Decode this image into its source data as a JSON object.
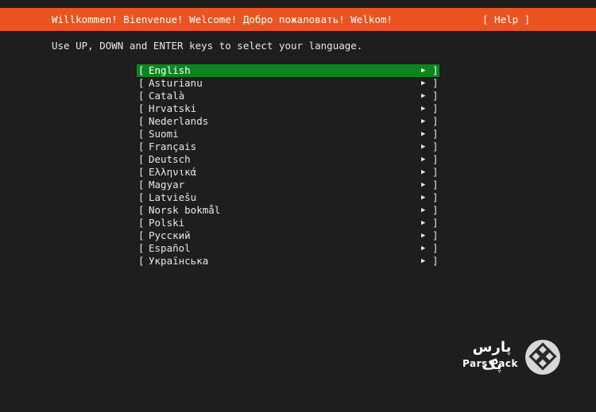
{
  "header": {
    "title": "Willkommen! Bienvenue! Welcome! Добро пожаловать! Welkom!",
    "help_label": "[ Help ]"
  },
  "instructions": "Use UP, DOWN and ENTER keys to select your language.",
  "languages": [
    {
      "label": "English",
      "selected": true
    },
    {
      "label": "Asturianu"
    },
    {
      "label": "Català"
    },
    {
      "label": "Hrvatski"
    },
    {
      "label": "Nederlands"
    },
    {
      "label": "Suomi"
    },
    {
      "label": "Français"
    },
    {
      "label": "Deutsch"
    },
    {
      "label": "Ελληνικά"
    },
    {
      "label": "Magyar"
    },
    {
      "label": "Latviešu"
    },
    {
      "label": "Norsk bokmål"
    },
    {
      "label": "Polski"
    },
    {
      "label": "Русский"
    },
    {
      "label": "Español"
    },
    {
      "label": "Українська"
    }
  ],
  "list_glyphs": {
    "open_bracket": "[",
    "close_bracket": "]",
    "arrow_icon": "▶"
  },
  "logo": {
    "text_fa": "پارس پک",
    "text_en": "Pars Pack",
    "icon": "parspack-logo-icon"
  },
  "colors": {
    "header_bg": "#e95420",
    "selected_bg": "#0e8420",
    "background": "#1e1e1e",
    "text": "#e6e6e6"
  }
}
